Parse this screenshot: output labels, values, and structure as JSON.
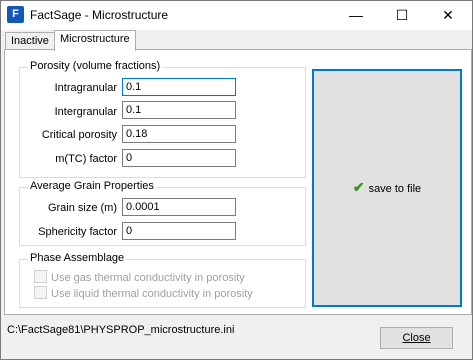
{
  "window": {
    "title": "FactSage - Microstructure"
  },
  "titlebar": {
    "minimize_glyph": "—",
    "maximize_glyph": "☐",
    "close_glyph": "✕"
  },
  "tabs": [
    {
      "label": "Inactive"
    },
    {
      "label": "Microstructure",
      "active": true
    }
  ],
  "porosity": {
    "legend": "Porosity (volume fractions)",
    "fields": [
      {
        "label": "Intragranular",
        "value": "0.1"
      },
      {
        "label": "Intergranular",
        "value": "0.1"
      },
      {
        "label": "Critical porosity",
        "value": "0.18"
      },
      {
        "label": "m(TC) factor",
        "value": "0"
      }
    ]
  },
  "grain": {
    "legend": "Average Grain Properties",
    "fields": [
      {
        "label": "Grain size (m)",
        "value": "0.0001"
      },
      {
        "label": "Sphericity factor",
        "value": "0"
      }
    ]
  },
  "phase": {
    "legend": "Phase Assemblage",
    "options": [
      {
        "label": "Use gas thermal conductivity in porosity",
        "checked": false,
        "enabled": false
      },
      {
        "label": "Use liquid thermal conductivity in porosity",
        "checked": false,
        "enabled": false
      }
    ]
  },
  "save_button": {
    "label": "save to file",
    "icon": "checkmark-icon",
    "icon_color": "#2f9a1a"
  },
  "status": {
    "path": "C:\\FactSage81\\PHYSPROP_microstructure.ini"
  },
  "close_button": {
    "label": "Close"
  },
  "colors": {
    "accent": "#0078d7"
  }
}
